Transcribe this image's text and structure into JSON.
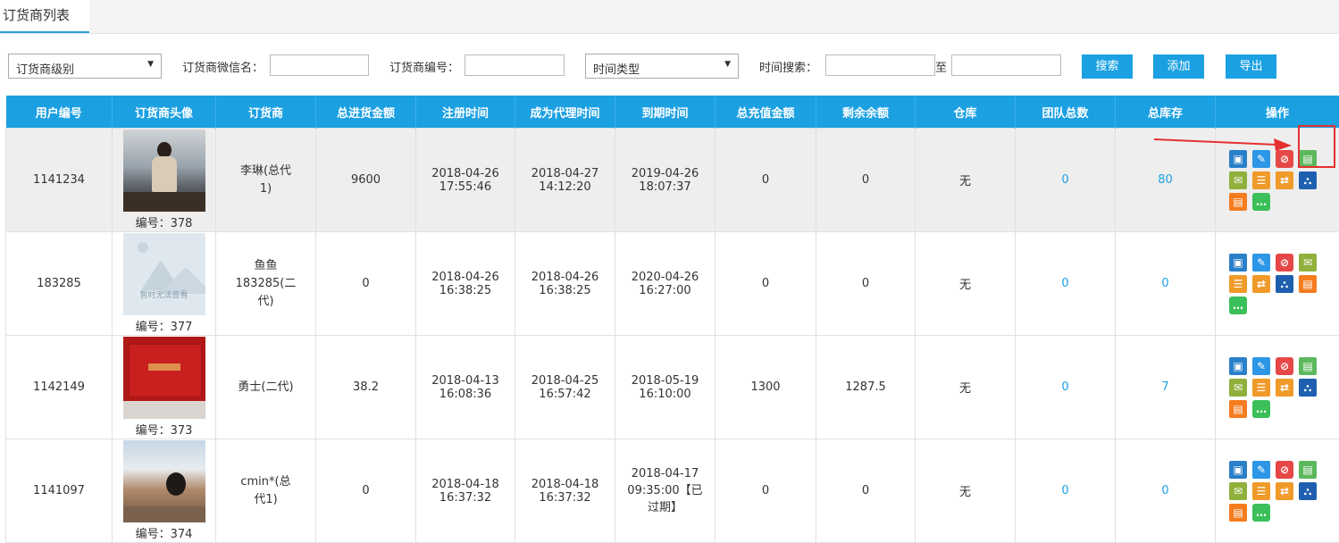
{
  "tabs": [
    {
      "label": "订货商列表"
    }
  ],
  "filters": {
    "level_select": "订货商级别",
    "wechat_label": "订货商微信名：",
    "wechat_value": "",
    "code_label": "订货商编号：",
    "code_value": "",
    "time_type_select": "时间类型",
    "time_search_label": "时间搜索：",
    "time_from": "",
    "to_label": "至",
    "time_to": "",
    "search_btn": "搜索",
    "add_btn": "添加",
    "export_btn": "导出"
  },
  "table": {
    "headers": [
      "用户编号",
      "订货商头像",
      "订货商",
      "总进货金额",
      "注册时间",
      "成为代理时间",
      "到期时间",
      "总充值金额",
      "剩余余额",
      "仓库",
      "团队总数",
      "总库存",
      "操作"
    ],
    "rows": [
      {
        "user_id": "1141234",
        "avatar_code": "编号：378",
        "name": "李琳(总代1)",
        "purchase": "9600",
        "reg_date": "2018-04-26",
        "reg_time": "17:55:46",
        "agent_date": "2018-04-27",
        "agent_time": "14:12:20",
        "expire_line1": "2019-04-26",
        "expire_line2": "18:07:37",
        "expire_line3": "",
        "recharge": "0",
        "balance": "0",
        "warehouse": "无",
        "team": "0",
        "stock": "80"
      },
      {
        "user_id": "183285",
        "avatar_code": "编号：377",
        "name": "鱼鱼183285(二代)",
        "purchase": "0",
        "reg_date": "2018-04-26",
        "reg_time": "16:38:25",
        "agent_date": "2018-04-26",
        "agent_time": "16:38:25",
        "expire_line1": "2020-04-26",
        "expire_line2": "16:27:00",
        "expire_line3": "",
        "recharge": "0",
        "balance": "0",
        "warehouse": "无",
        "team": "0",
        "stock": "0"
      },
      {
        "user_id": "1142149",
        "avatar_code": "编号：373",
        "name": "勇士(二代)",
        "purchase": "38.2",
        "reg_date": "2018-04-13",
        "reg_time": "16:08:36",
        "agent_date": "2018-04-25",
        "agent_time": "16:57:42",
        "expire_line1": "2018-05-19",
        "expire_line2": "16:10:00",
        "expire_line3": "",
        "recharge": "1300",
        "balance": "1287.5",
        "warehouse": "无",
        "team": "0",
        "stock": "7"
      },
      {
        "user_id": "1141097",
        "avatar_code": "编号：374",
        "name": "cmin*(总代1)",
        "purchase": "0",
        "reg_date": "2018-04-18",
        "reg_time": "16:37:32",
        "agent_date": "2018-04-18",
        "agent_time": "16:37:32",
        "expire_line1": "2018-04-17",
        "expire_line2": "09:35:00【已",
        "expire_line3": "过期】",
        "recharge": "0",
        "balance": "0",
        "warehouse": "无",
        "team": "0",
        "stock": "0"
      }
    ],
    "placeholder_image_text": "暂时无法查看"
  },
  "colors": {
    "header_bg": "#1ba0e2",
    "button_bg": "#1ba0e2",
    "link": "#1ba0e2",
    "annotation": "#e53030"
  },
  "icons": [
    "edit-icon",
    "pencil-icon",
    "ban-icon",
    "settings-doc-icon",
    "money-icon",
    "list-icon",
    "transfer-icon",
    "team-icon",
    "order-history-icon",
    "chat-icon"
  ]
}
